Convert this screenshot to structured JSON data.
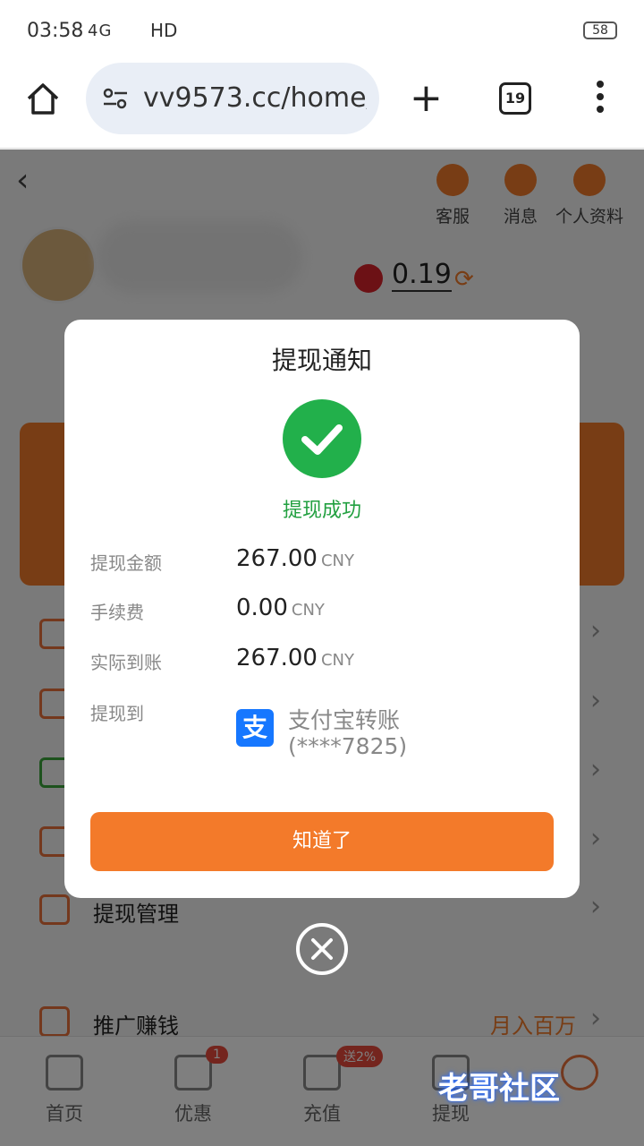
{
  "status_bar": {
    "time": "03:58",
    "network": "4G",
    "quality": "HD",
    "battery": "58"
  },
  "browser": {
    "url": "vv9573.cc/home/",
    "tab_count": "19"
  },
  "page": {
    "header_actions": [
      "客服",
      "消息",
      "个人资料"
    ],
    "balance": "0.19",
    "menu": [
      {
        "label": "",
        "extra": ""
      },
      {
        "label": "",
        "extra": ""
      },
      {
        "label": "",
        "extra": ""
      },
      {
        "label": "",
        "extra": ""
      },
      {
        "label": "提现管理",
        "extra": ""
      },
      {
        "label": "推广赚钱",
        "extra": "月入百万"
      }
    ],
    "tabbar": [
      {
        "label": "首页"
      },
      {
        "label": "优惠",
        "badge": "1"
      },
      {
        "label": "充值",
        "badge": "送2%"
      },
      {
        "label": "提现"
      },
      {
        "label": ""
      }
    ]
  },
  "dialog": {
    "title": "提现通知",
    "status_text": "提现成功",
    "rows": [
      {
        "label": "提现金额",
        "value": "267.00",
        "currency": "CNY"
      },
      {
        "label": "手续费",
        "value": "0.00",
        "currency": "CNY"
      },
      {
        "label": "实际到账",
        "value": "267.00",
        "currency": "CNY"
      }
    ],
    "dest_label": "提现到",
    "dest_logo_char": "支",
    "dest_name": "支付宝转账",
    "dest_account": "(****7825)",
    "confirm_button": "知道了"
  },
  "watermark": "老哥社区",
  "colors": {
    "accent": "#f37a2a",
    "success": "#22b04b",
    "alipay": "#1677ff"
  },
  "icons": [
    "home-icon",
    "tune-icon",
    "plus-icon",
    "tabs-icon",
    "more-icon",
    "back-icon",
    "headset-icon",
    "message-icon",
    "profile-icon",
    "refresh-icon",
    "check-icon",
    "alipay-icon",
    "close-icon"
  ]
}
